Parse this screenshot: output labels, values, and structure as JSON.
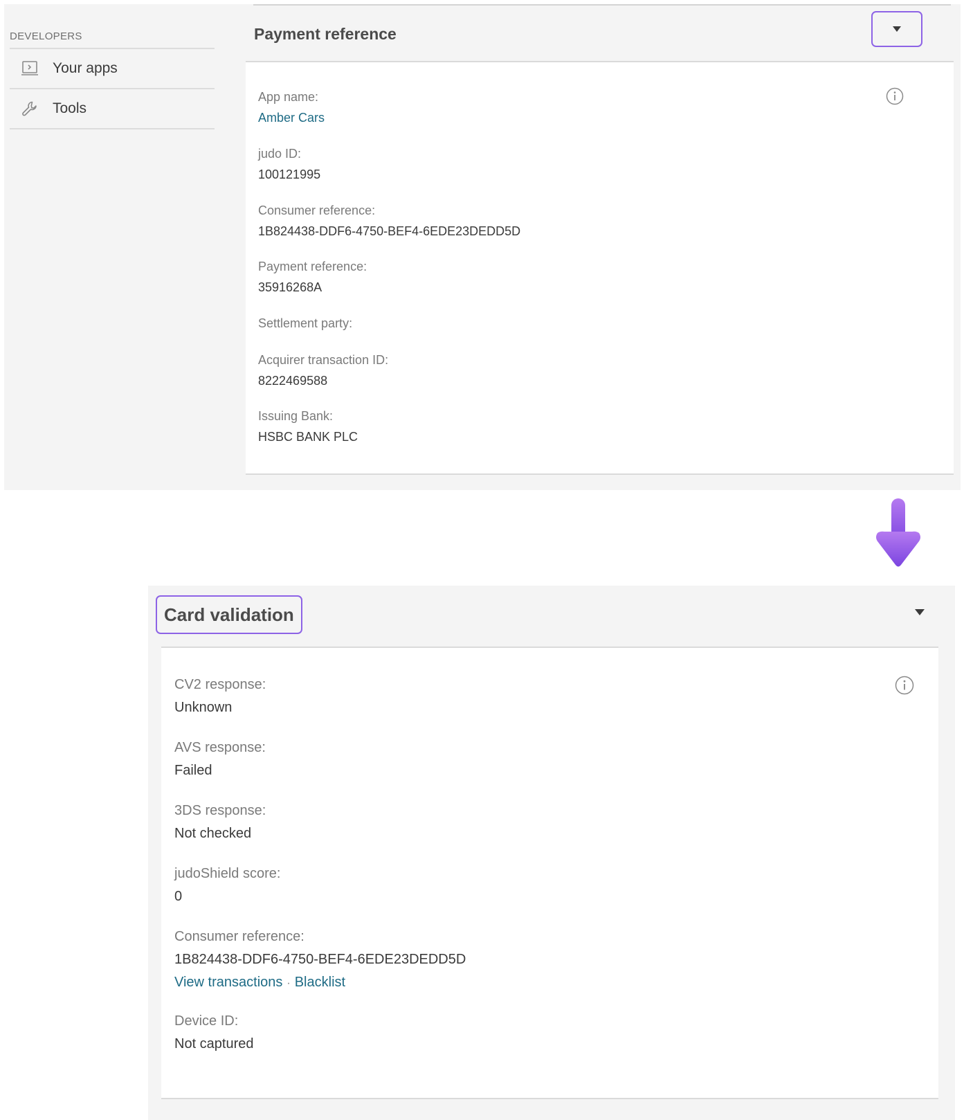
{
  "sidebar": {
    "heading": "DEVELOPERS",
    "items": [
      {
        "label": "Your apps",
        "icon": "laptop-icon"
      },
      {
        "label": "Tools",
        "icon": "wrench-icon"
      }
    ]
  },
  "payment_panel": {
    "title": "Payment reference",
    "fields": [
      {
        "label": "App name:",
        "value": "Amber Cars"
      },
      {
        "label": "judo ID:",
        "value": "100121995"
      },
      {
        "label": "Consumer reference:",
        "value": "1B824438-DDF6-4750-BEF4-6EDE23DEDD5D"
      },
      {
        "label": "Payment reference:",
        "value": "35916268A"
      },
      {
        "label": "Settlement party:",
        "value": ""
      },
      {
        "label": "Acquirer transaction ID:",
        "value": "8222469588"
      },
      {
        "label": "Issuing Bank:",
        "value": "HSBC BANK PLC"
      }
    ]
  },
  "card_validation_panel": {
    "title": "Card validation",
    "fields": [
      {
        "label": "CV2 response:",
        "value": "Unknown"
      },
      {
        "label": "AVS response:",
        "value": "Failed"
      },
      {
        "label": "3DS response:",
        "value": "Not checked"
      },
      {
        "label": "judoShield score:",
        "value": "0"
      },
      {
        "label": "Consumer reference:",
        "value": "1B824438-DDF6-4750-BEF4-6EDE23DEDD5D"
      },
      {
        "label": "Device ID:",
        "value": "Not captured"
      }
    ],
    "links": {
      "view_transactions": "View transactions",
      "separator": "·",
      "blacklist": "Blacklist"
    }
  },
  "colors": {
    "highlight": "#8d63e6",
    "link": "#1e6b85",
    "arrow": "#8a4ee6"
  }
}
